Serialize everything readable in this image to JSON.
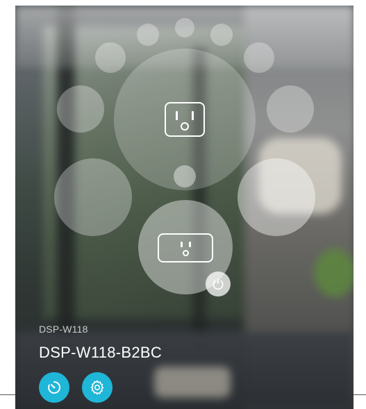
{
  "device": {
    "model": "DSP-W118",
    "name": "DSP-W118-B2BC"
  },
  "controls": {
    "schedule_icon": "timer-icon",
    "settings_icon": "gear-icon",
    "power_icon": "power-icon"
  },
  "colors": {
    "accent": "#1fb6d8",
    "bubble": "rgba(255,255,255,0.30)"
  }
}
